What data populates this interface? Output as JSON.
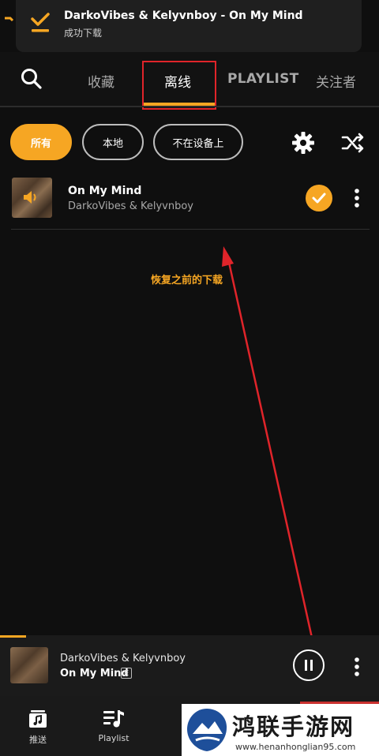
{
  "notification": {
    "title": "DarkoVibes & Kelyvnboy - On My Mind",
    "subtitle": "成功下载"
  },
  "nav": {
    "tabs": [
      {
        "label": "收藏"
      },
      {
        "label": "离线"
      },
      {
        "label": "PLAYLIST"
      },
      {
        "label": "关注者"
      }
    ],
    "active_tab": "离线"
  },
  "filters": {
    "chips": [
      {
        "label": "所有"
      },
      {
        "label": "本地"
      },
      {
        "label": "不在设备上"
      }
    ],
    "selected": "所有"
  },
  "tracks": [
    {
      "title": "On My Mind",
      "artist": "DarkoVibes & Kelyvnboy"
    }
  ],
  "annotation": {
    "text": "恢复之前的下载"
  },
  "player": {
    "artist": "DarkoVibes & Kelyvnboy",
    "title": "On My Mind",
    "explicit": "E"
  },
  "bottom_nav": {
    "items": [
      {
        "label": "推送",
        "icon": "music-note-box-icon"
      },
      {
        "label": "Playlist",
        "icon": "playlist-icon"
      }
    ]
  },
  "watermark": {
    "brand": "鸿联手游网",
    "url": "www.henanhonglian95.com"
  },
  "colors": {
    "accent": "#f6a623",
    "background": "#0f0f0f",
    "annotation_red": "#e0242a"
  }
}
